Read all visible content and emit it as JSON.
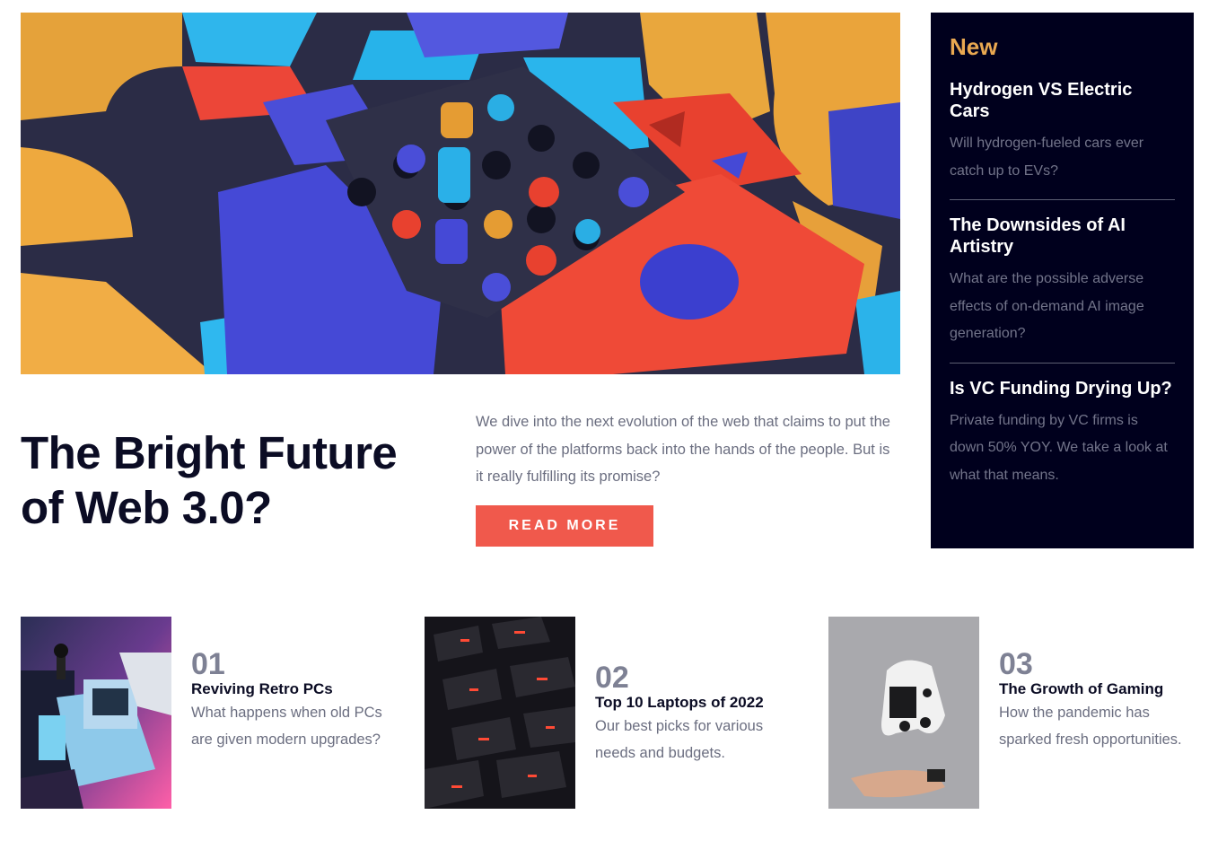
{
  "hero": {
    "headline": "The Bright Future of Web 3.0?",
    "lede": "We dive into the next evolution of the web that claims to put the power of the platforms back into the hands of the people. But is it really fulfilling its promise?",
    "cta_label": "READ MORE"
  },
  "sidebar": {
    "title": "New",
    "items": [
      {
        "title": "Hydrogen VS Electric Cars",
        "desc": "Will hydrogen-fueled cars ever catch up to EVs?"
      },
      {
        "title": "The Downsides of AI Artistry",
        "desc": "What are the possible adverse effects of on-demand AI image generation?"
      },
      {
        "title": "Is VC Funding Drying Up?",
        "desc": "Private funding by VC firms is down 50% YOY. We take a look at what that means."
      }
    ]
  },
  "cards": [
    {
      "num": "01",
      "title": "Reviving Retro PCs",
      "desc": "What happens when old PCs are given modern upgrades?"
    },
    {
      "num": "02",
      "title": "Top 10 Laptops of 2022",
      "desc": "Our best picks for various needs and budgets."
    },
    {
      "num": "03",
      "title": "The Growth of Gaming",
      "desc": "How the pandemic has sparked fresh opportunities."
    }
  ],
  "colors": {
    "accent": "#f0594c",
    "sidebar_bg": "#00001d",
    "sidebar_title": "#e9a851",
    "heading": "#0b0c24",
    "body_text": "#6b6e80"
  }
}
